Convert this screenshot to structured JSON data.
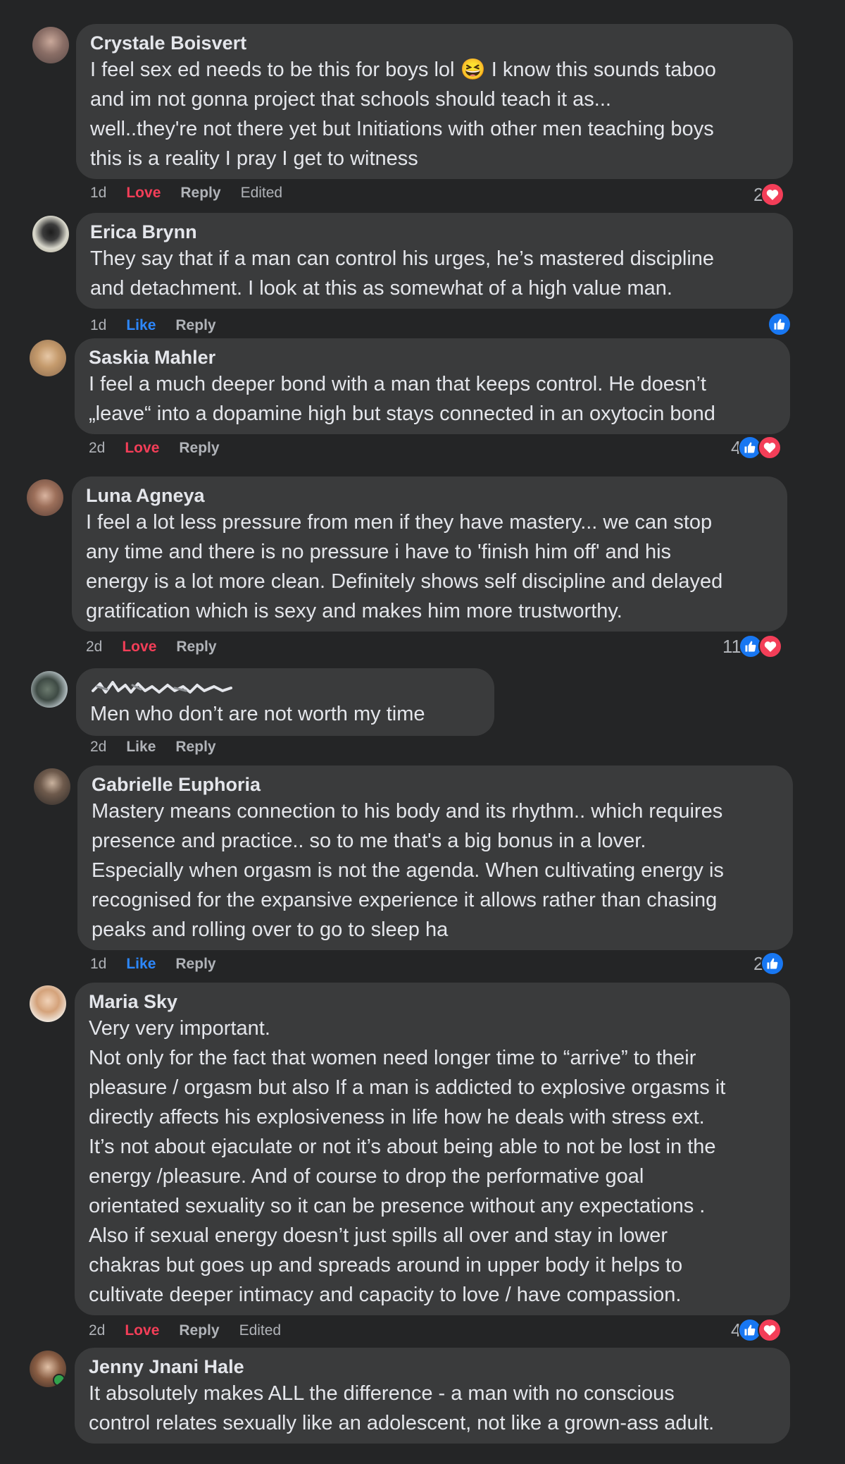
{
  "comments": [
    {
      "author": "Crystale Boisvert",
      "text_a": "I feel sex ed needs to be this for boys lol",
      "emoji": "😆",
      "text_b": "I know this sounds taboo\nand im not gonna project that schools should teach it as...\nwell..they're not there yet but Initiations with other men teaching boys\nthis is a reality I pray I get to witness",
      "time": "1d",
      "reaction_action": "Love",
      "reply": "Reply",
      "edited": "Edited",
      "reaction_count": "2"
    },
    {
      "author": "Erica Brynn",
      "text": "They say that if a man can control his urges, he’s mastered discipline\nand detachment. I look at this as somewhat of a high value man.",
      "time": "1d",
      "reaction_action": "Like",
      "reply": "Reply"
    },
    {
      "author": "Saskia Mahler",
      "text": "I feel a much deeper bond with a man that keeps control. He doesn’t\n„leave“ into a dopamine high but stays connected in an oxytocin bond",
      "time": "2d",
      "reaction_action": "Love",
      "reply": "Reply",
      "reaction_count": "4"
    },
    {
      "author": "Luna Agneya",
      "text": "I feel a lot less pressure from men if they have mastery... we can stop\nany time and there is no pressure i have to 'finish him off' and his\nenergy is a lot more clean. Definitely shows self discipline and delayed\ngratification which is sexy and makes him more trustworthy.",
      "time": "2d",
      "reaction_action": "Love",
      "reply": "Reply",
      "reaction_count": "11"
    },
    {
      "text": "Men who don’t are not worth my time",
      "time": "2d",
      "reaction_action": "Like",
      "reply": "Reply"
    },
    {
      "author": "Gabrielle Euphoria",
      "text": "Mastery means connection to his body and its rhythm.. which requires\npresence and practice.. so to me that's a big bonus in a lover.\nEspecially when orgasm is not the agenda. When cultivating energy is\nrecognised for the expansive experience it allows rather than chasing\npeaks and rolling over to go to sleep ha",
      "time": "1d",
      "reaction_action": "Like",
      "reply": "Reply",
      "reaction_count": "2"
    },
    {
      "author": "Maria Sky",
      "text": "Very very important.\nNot only for the fact that women need longer time to “arrive” to their\npleasure / orgasm but also If a man is addicted to explosive orgasms it\ndirectly affects his explosiveness in life how he deals with stress ext.\nIt’s not about ejaculate or not it’s about being able to not be lost in the\nenergy /pleasure. And of course to drop the performative goal\norientated sexuality so it can be presence without any expectations .\nAlso if sexual energy doesn’t just spills all over and stay in lower\nchakras but goes up and spreads around in upper body it helps to\ncultivate deeper intimacy and capacity to love / have compassion.",
      "time": "2d",
      "reaction_action": "Love",
      "reply": "Reply",
      "edited": "Edited",
      "reaction_count": "4"
    },
    {
      "author": "Jenny Jnani Hale",
      "text": "It absolutely makes ALL the difference - a man with no conscious\ncontrol relates sexually like an adolescent, not like a grown-ass adult."
    }
  ],
  "colors": {
    "background": "#242526",
    "bubble": "#3a3b3c",
    "love": "#f33e58",
    "like": "#2d88ff",
    "like_icon": "#1877f2",
    "muted": "#b0b3b8",
    "online": "#31a24c"
  },
  "icons": [
    "like-reaction-icon",
    "love-reaction-icon",
    "laughing-emoji"
  ]
}
